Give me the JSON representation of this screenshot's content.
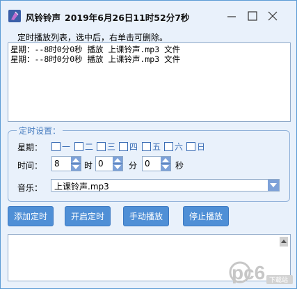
{
  "window": {
    "app_name": "风铃铃声",
    "datetime": "2019年6月26日11时52分7秒"
  },
  "list": {
    "label": "定时播放列表，选中后，右单击可删除。",
    "items": [
      "星期：--8时0分0秒 播放 上课铃声.mp3 文件",
      "星期：--8时0分0秒 播放 上课铃声.mp3 文件"
    ]
  },
  "settings": {
    "legend": "定时设置：",
    "weekday_label": "星期：",
    "days": [
      "一",
      "二",
      "三",
      "四",
      "五",
      "六",
      "日"
    ],
    "time_label": "时间：",
    "hour_value": "8",
    "hour_unit": "时",
    "minute_value": "0",
    "minute_unit": "分",
    "second_value": "0",
    "second_unit": "秒",
    "music_label": "音乐：",
    "music_value": "上课铃声.mp3"
  },
  "buttons": {
    "add": "添加定时",
    "start": "开启定时",
    "manual": "手动播放",
    "stop": "停止播放"
  },
  "watermark": {
    "brand": "pc6",
    "sub": "下载站"
  },
  "colors": {
    "accent": "#4f8fd6",
    "legend": "#4a7fc1",
    "window_bg": "#e9f1fb"
  }
}
